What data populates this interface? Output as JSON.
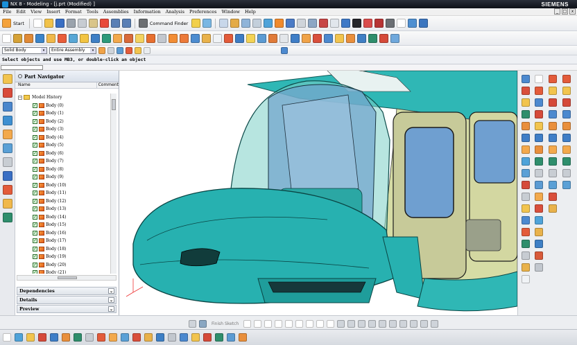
{
  "window": {
    "title": "NX 8 - Modeling - [j.prt (Modified) ]",
    "brand": "SIEMENS",
    "controls": [
      "_",
      "□",
      "x"
    ]
  },
  "menu": [
    "File",
    "Edit",
    "View",
    "Insert",
    "Format",
    "Tools",
    "Assemblies",
    "Information",
    "Analysis",
    "Preferences",
    "Window",
    "Help"
  ],
  "toolbar1": {
    "start_label": "Start",
    "command_finder_label": "Command Finder"
  },
  "toolbar3": {
    "filter_value": "Solid Body",
    "scope_value": "Entire Assembly"
  },
  "prompt": "Select objects and use MB3, or double-click an object",
  "navigator": {
    "title": "Part Navigator",
    "col_name": "Name",
    "col_comment": "Comment",
    "root": "Model History",
    "bodies": [
      "Body (0)",
      "Body (1)",
      "Body (2)",
      "Body (3)",
      "Body (4)",
      "Body (5)",
      "Body (6)",
      "Body (7)",
      "Body (8)",
      "Body (9)",
      "Body (10)",
      "Body (11)",
      "Body (12)",
      "Body (13)",
      "Body (14)",
      "Body (15)",
      "Body (16)",
      "Body (17)",
      "Body (18)",
      "Body (19)",
      "Body (20)",
      "Body (21)"
    ],
    "panels": [
      "Dependencies",
      "Details",
      "Preview"
    ]
  },
  "bottom_toolbar": {
    "sketch_label": "Finish Sketch"
  },
  "colors": {
    "hull_teal": "#27b1b0",
    "interior_green": "#d6dca5",
    "glass_blue": "#6f9fd0",
    "accent_orange": "#f08a2c"
  },
  "icons": {
    "start": "start-icon",
    "command_finder": "binoculars-icon",
    "body": "solid-body-icon",
    "folder": "folder-icon"
  }
}
